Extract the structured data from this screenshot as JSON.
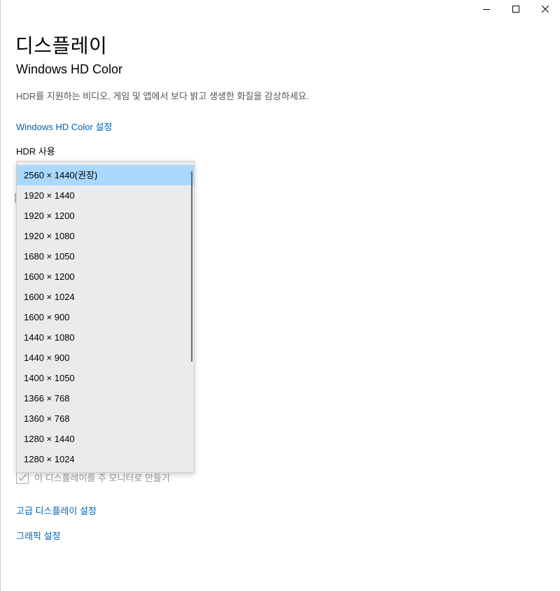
{
  "window": {
    "title": "디스플레이",
    "controls": {
      "minimize_icon": "minimize-icon",
      "maximize_icon": "maximize-icon",
      "close_icon": "close-icon"
    }
  },
  "hd_color": {
    "heading": "Windows HD Color",
    "description": "HDR를 지원하는 비디오, 게임 및 앱에서 보다 밝고 생생한 화질을 감상하세요.",
    "link": "Windows HD Color 설정",
    "hdr_label": "HDR 사용"
  },
  "resolution_dropdown": {
    "selected_index": 0,
    "options": [
      "2560 × 1440(권장)",
      "1920 × 1440",
      "1920 × 1200",
      "1920 × 1080",
      "1680 × 1050",
      "1600 × 1200",
      "1600 × 1024",
      "1600 × 900",
      "1440 × 1080",
      "1440 × 900",
      "1400 × 1050",
      "1366 × 768",
      "1360 × 768",
      "1280 × 1440",
      "1280 × 1024"
    ]
  },
  "main_monitor_checkbox": {
    "label": "이 디스플레이를 주 모니터로 만들기",
    "checked": true
  },
  "links": {
    "advanced": "고급 디스플레이 설정",
    "graphics": "그래픽 설정"
  },
  "colors": {
    "link": "#0063b1",
    "selected_item": "#a9d9ff",
    "dropdown_bg": "#ebebeb"
  }
}
